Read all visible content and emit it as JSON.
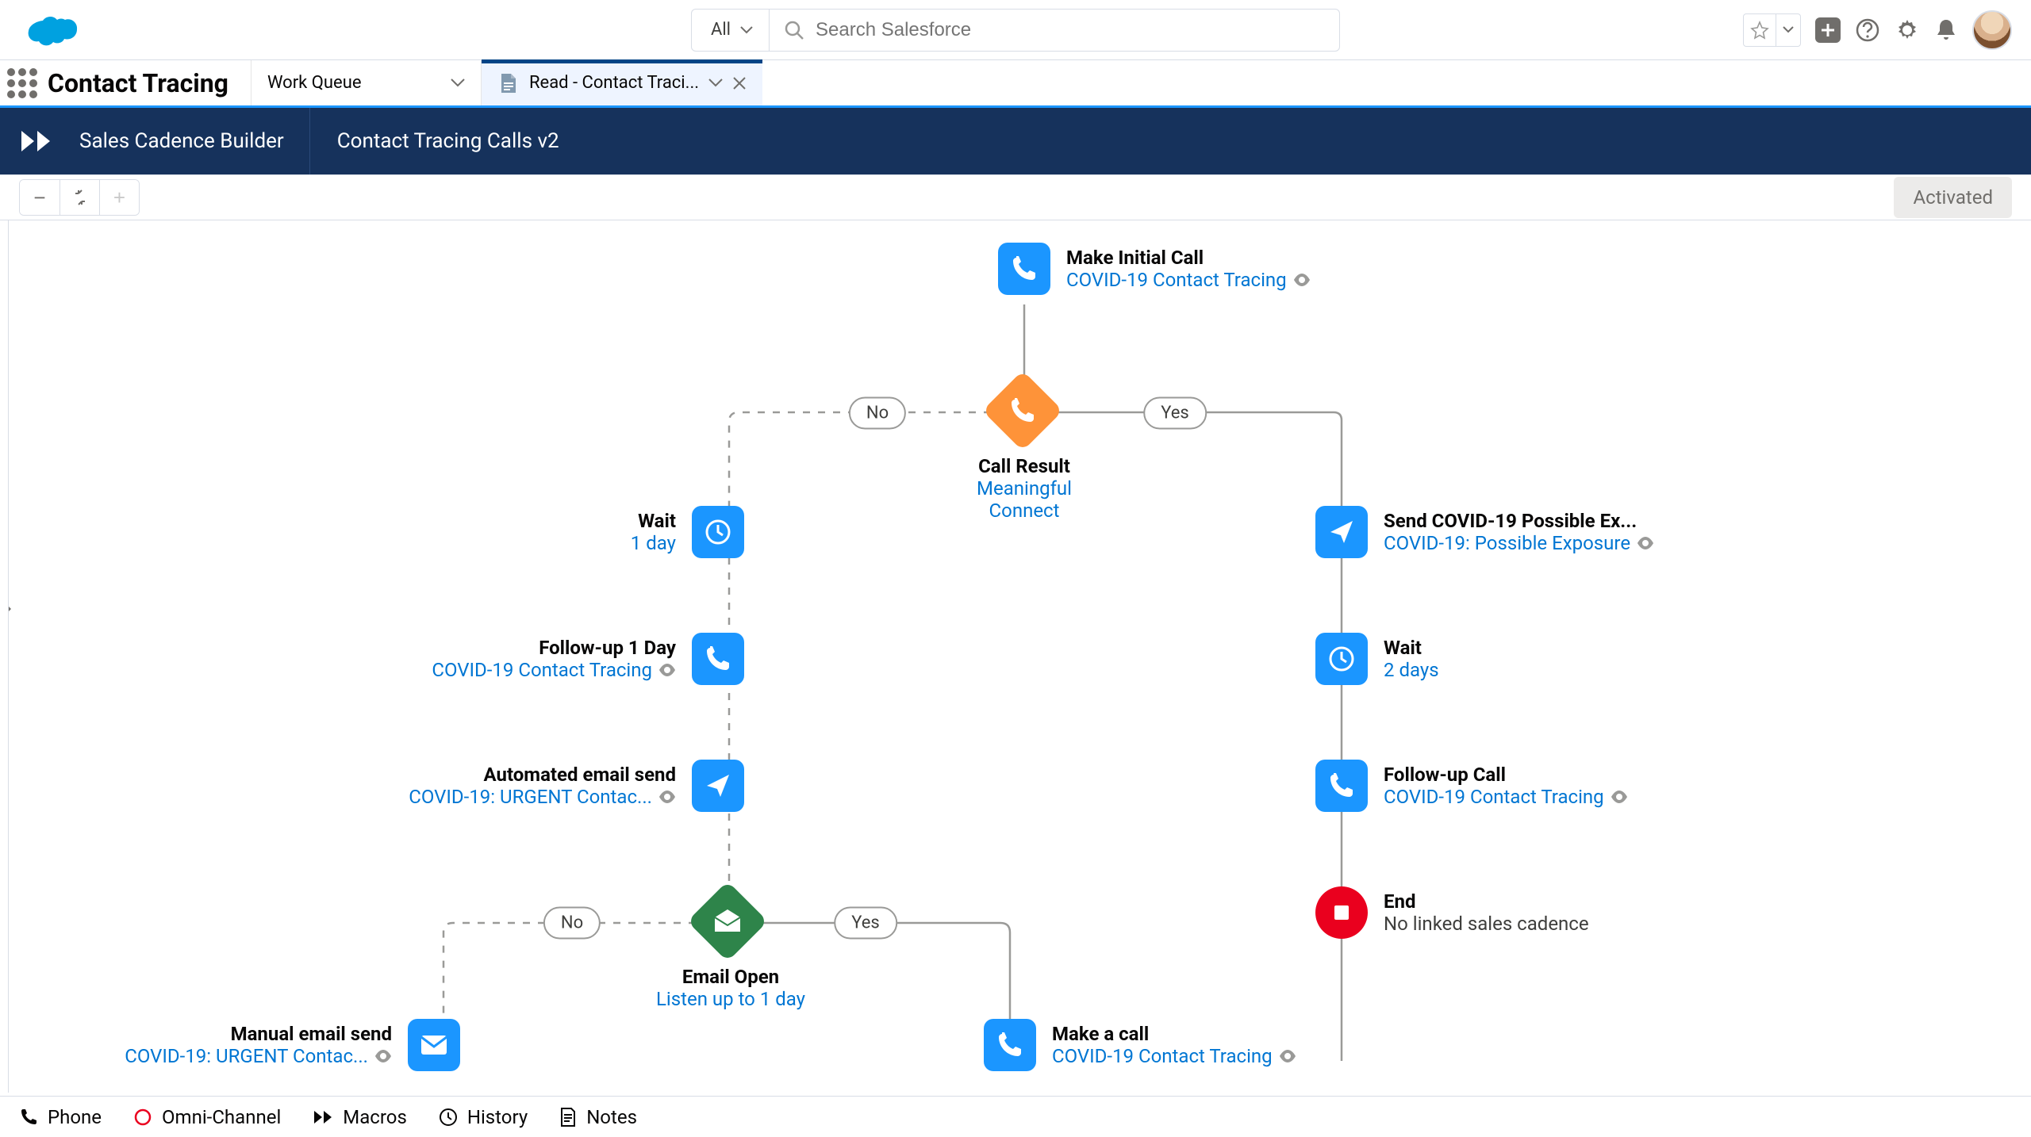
{
  "app_name": "Contact Tracing",
  "search": {
    "scope": "All",
    "placeholder": "Search Salesforce"
  },
  "tabs": {
    "primary": "Work Queue",
    "secondary": "Read - Contact Traci..."
  },
  "builder": {
    "crumb": "Sales Cadence Builder",
    "title": "Contact Tracing Calls v2",
    "status": "Activated"
  },
  "labels": {
    "yes": "Yes",
    "no": "No"
  },
  "nodes": {
    "initial_call": {
      "title": "Make Initial Call",
      "subtitle": "COVID-19 Contact Tracing"
    },
    "call_result": {
      "title": "Call Result",
      "subtitle": "Meaningful Connect"
    },
    "wait_1": {
      "title": "Wait",
      "subtitle": "1 day"
    },
    "followup_1day": {
      "title": "Follow-up 1 Day",
      "subtitle": "COVID-19 Contact Tracing"
    },
    "auto_email": {
      "title": "Automated email send",
      "subtitle": "COVID-19: URGENT Contac..."
    },
    "email_open": {
      "title": "Email Open",
      "subtitle": "Listen up to 1 day"
    },
    "manual_email": {
      "title": "Manual email send",
      "subtitle": "COVID-19: URGENT Contac..."
    },
    "make_call": {
      "title": "Make a call",
      "subtitle": "COVID-19 Contact Tracing"
    },
    "send_exposure": {
      "title": "Send COVID-19 Possible Ex...",
      "subtitle": "COVID-19: Possible Exposure"
    },
    "wait_2": {
      "title": "Wait",
      "subtitle": "2 days"
    },
    "followup_call": {
      "title": "Follow-up Call",
      "subtitle": "COVID-19 Contact Tracing"
    },
    "end": {
      "title": "End",
      "subtitle": "No linked sales cadence"
    }
  },
  "utility": {
    "phone": "Phone",
    "omni": "Omni-Channel",
    "macros": "Macros",
    "history": "History",
    "notes": "Notes"
  }
}
